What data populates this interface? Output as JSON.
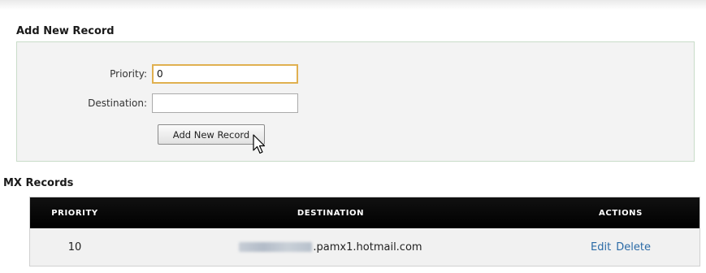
{
  "add_section": {
    "title": "Add New Record",
    "priority_label": "Priority:",
    "priority_value": "0",
    "destination_label": "Destination:",
    "destination_value": "",
    "submit_label": "Add New Record"
  },
  "mx_section": {
    "title": "MX Records",
    "columns": [
      "Priority",
      "Destination",
      "Actions"
    ],
    "rows": [
      {
        "priority": "10",
        "destination_suffix": ".pamx1.hotmail.com",
        "edit_label": "Edit",
        "delete_label": "Delete"
      }
    ]
  },
  "colors": {
    "link": "#2a6aa6",
    "header_bg": "#000000",
    "panel_bg": "#f3f3f3",
    "focus_border": "#e0b050"
  },
  "icons": [
    "mouse-pointer-icon"
  ]
}
